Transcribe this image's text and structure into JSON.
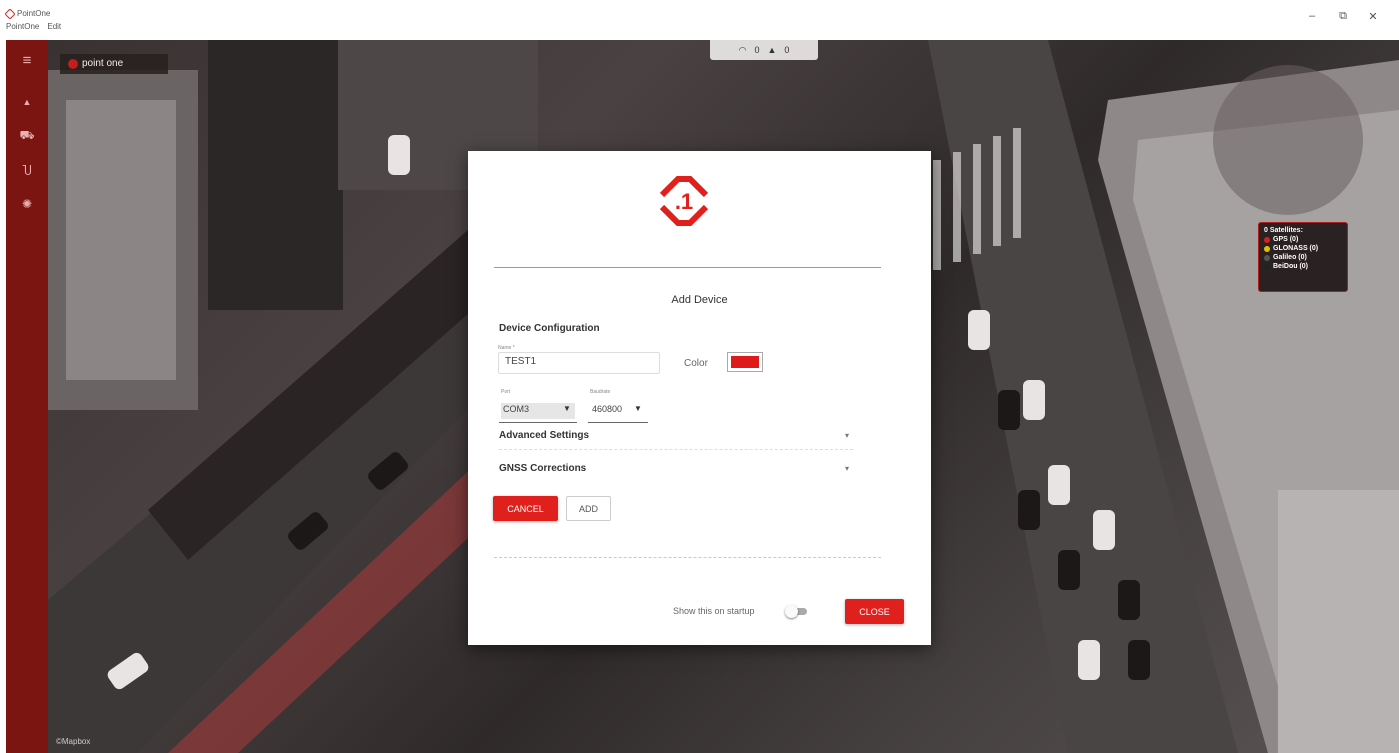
{
  "window": {
    "title": "PointOne",
    "menu": [
      "PointOne",
      "Edit"
    ],
    "controls": {
      "minimize": "–",
      "maximize": "⧉",
      "close": "✕"
    }
  },
  "sidebar": {
    "items": [
      {
        "icon": "menu-icon",
        "glyph": "≡"
      },
      {
        "icon": "navigation-icon",
        "glyph": "▲"
      },
      {
        "icon": "car-icon",
        "glyph": "⛟"
      },
      {
        "icon": "antenna-icon",
        "glyph": "Ⴎ"
      },
      {
        "icon": "settings-icon",
        "glyph": "✺"
      }
    ]
  },
  "map": {
    "brand_chip": "point one",
    "top_status": {
      "wifi_label": "0",
      "bell_label": "0"
    },
    "satellites": {
      "title": "0 Satellites:",
      "entries": [
        {
          "label": "GPS (0)",
          "color": "#d62020"
        },
        {
          "label": "GLONASS (0)",
          "color": "#e0c000"
        },
        {
          "label": "Galileo (0)",
          "color": "#333333"
        },
        {
          "label": "BeiDou (0)",
          "color": "#111111"
        }
      ]
    },
    "attribution": "©Mapbox"
  },
  "dialog": {
    "title": "Add Device",
    "section_label": "Device Configuration",
    "name": {
      "label": "Name *",
      "value": "TEST1"
    },
    "color_label": "Color",
    "color_value": "#e01a1a",
    "port": {
      "label": "Port",
      "value": "COM3"
    },
    "baud": {
      "label": "Baudrate",
      "value": "460800"
    },
    "advanced_settings": "Advanced Settings",
    "gnss_corrections": "GNSS Corrections",
    "cancel_label": "CANCEL",
    "add_label": "ADD",
    "startup_label": "Show this on startup",
    "close_label": "CLOSE",
    "accent": "#e0201c"
  }
}
